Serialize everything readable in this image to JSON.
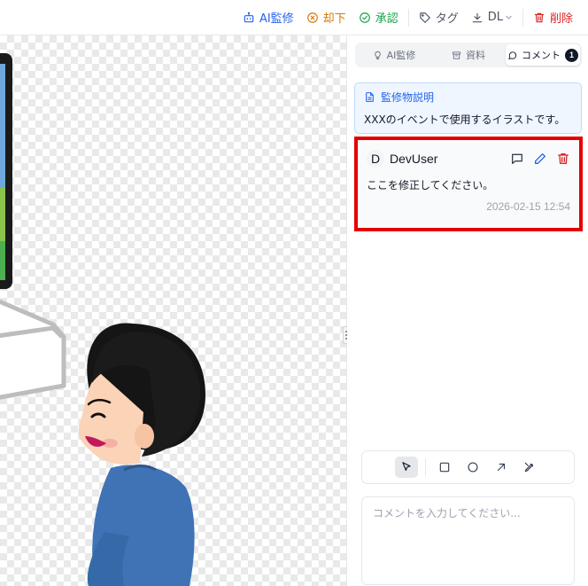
{
  "toolbar": {
    "ai_review": "AI監修",
    "reject": "却下",
    "approve": "承認",
    "tag": "タグ",
    "download": "DL",
    "delete": "削除"
  },
  "tabs": [
    {
      "label": "AI監修",
      "icon": "lightbulb-icon"
    },
    {
      "label": "資料",
      "icon": "archive-icon"
    },
    {
      "label": "コメント",
      "icon": "message-icon",
      "badge": "1",
      "active": true
    }
  ],
  "description": {
    "title": "監修物説明",
    "text": "XXXのイベントで使用するイラストです。"
  },
  "comment": {
    "avatar_letter": "D",
    "author": "DevUser",
    "body": "ここを修正してください。",
    "timestamp": "2026-02-15 12:54"
  },
  "drawing_tools": [
    "pointer-icon",
    "rectangle-icon",
    "circle-icon",
    "arrow-icon",
    "pen-icon"
  ],
  "input": {
    "placeholder": "コメントを入力してください..."
  },
  "colors": {
    "accent_blue": "#2563eb",
    "reject_orange": "#d97706",
    "approve_green": "#16a34a",
    "delete_red": "#dc2626",
    "highlight_border": "#e40000"
  }
}
